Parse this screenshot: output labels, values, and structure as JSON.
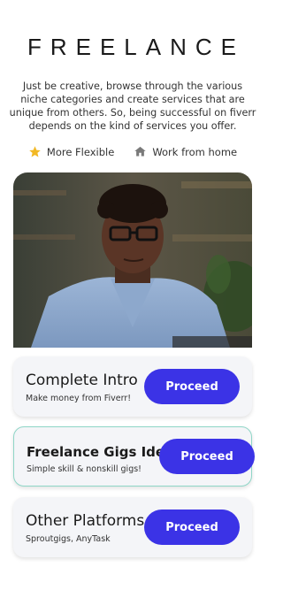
{
  "header": {
    "title": "FREELANCE",
    "description": "Just be creative, browse through the various niche categories and create services that are unique from others. So, being successful on fiverr depends on the kind of services you offer."
  },
  "features": [
    {
      "icon": "star-icon",
      "label": "More Flexible",
      "color": "#f2b824"
    },
    {
      "icon": "home-icon",
      "label": "Work from home",
      "color": "#7a7a7a"
    }
  ],
  "hero": {
    "icon": "man-with-glasses-photo"
  },
  "cards": [
    {
      "title": "Complete Intro",
      "subtitle": "Make money from Fiverr!",
      "button": "Proceed"
    },
    {
      "title": "Freelance Gigs Ideas",
      "subtitle": "Simple skill & nonskill gigs!",
      "button": "Proceed"
    },
    {
      "title": "Other Platforms",
      "subtitle": "Sproutgigs, AnyTask",
      "button": "Proceed"
    }
  ],
  "colors": {
    "accent": "#3b33e6",
    "active_border": "#8fd6c7",
    "card_bg": "#f4f5f8"
  }
}
